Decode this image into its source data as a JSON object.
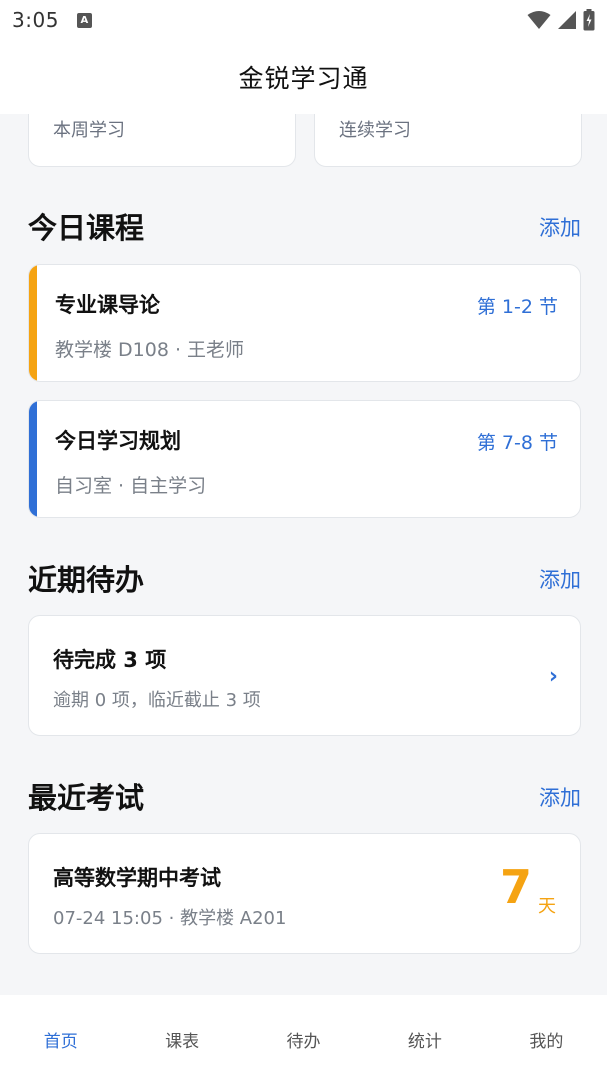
{
  "status_bar": {
    "time": "3:05",
    "notification_icon": "A"
  },
  "header": {
    "title": "金锐学习通"
  },
  "stats": {
    "week_label": "本周学习",
    "streak_label": "连续学习"
  },
  "today_courses": {
    "title": "今日课程",
    "add_label": "添加",
    "items": [
      {
        "name": "专业课导论",
        "period": "第 1-2 节",
        "meta": "教学楼 D108 · 王老师",
        "color": "#f5a312"
      },
      {
        "name": "今日学习规划",
        "period": "第 7-8 节",
        "meta": "自习室 · 自主学习",
        "color": "#2f6fd6"
      }
    ]
  },
  "todos": {
    "title": "近期待办",
    "add_label": "添加",
    "summary_title": "待完成 3 项",
    "summary_sub": "逾期 0 项，临近截止 3 项",
    "chevron": "›"
  },
  "exams": {
    "title": "最近考试",
    "add_label": "添加",
    "item": {
      "name": "高等数学期中考试",
      "meta": "07-24 15:05 · 教学楼 A201",
      "days": "7",
      "unit": "天"
    }
  },
  "tabs": [
    {
      "label": "首页",
      "active": true
    },
    {
      "label": "课表",
      "active": false
    },
    {
      "label": "待办",
      "active": false
    },
    {
      "label": "统计",
      "active": false
    },
    {
      "label": "我的",
      "active": false
    }
  ],
  "colors": {
    "accent": "#2f6fd6",
    "orange": "#f5a312",
    "background": "#f5f6f8"
  }
}
